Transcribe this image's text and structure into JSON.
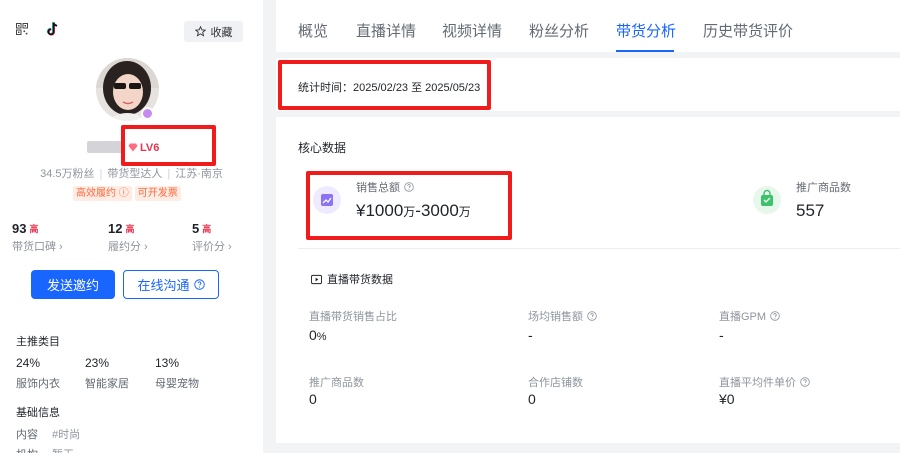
{
  "profile": {
    "favorite_label": "收藏",
    "level": "LV6",
    "fans": "34.5万粉丝",
    "type": "带货型达人",
    "location": "江苏·南京",
    "tags": [
      "高效履约",
      "可开发票"
    ]
  },
  "stats": [
    {
      "value": "93",
      "rank": "高",
      "label": "带货口碑"
    },
    {
      "value": "12",
      "rank": "高",
      "label": "履约分"
    },
    {
      "value": "5",
      "rank": "高",
      "label": "评价分"
    }
  ],
  "actions": {
    "invite": "发送邀约",
    "chat": "在线沟通"
  },
  "categories": {
    "title": "主推类目",
    "items": [
      {
        "pct": "24%",
        "name": "服饰内衣"
      },
      {
        "pct": "23%",
        "name": "智能家居"
      },
      {
        "pct": "13%",
        "name": "母婴宠物"
      }
    ]
  },
  "basic_info": {
    "title": "基础信息",
    "content_label": "内容",
    "content_value": "#时尚",
    "org_label": "机构",
    "org_value": "暂无"
  },
  "tabs": [
    "概览",
    "直播详情",
    "视频详情",
    "粉丝分析",
    "带货分析",
    "历史带货评价"
  ],
  "active_tab": "带货分析",
  "date_range": "统计时间：2025/02/23 至 2025/05/23",
  "core": {
    "title": "核心数据",
    "sales_label": "销售总额",
    "sales_value_a": "¥1000",
    "sales_unit_a": "万",
    "sales_sep": "-",
    "sales_value_b": "3000",
    "sales_unit_b": "万",
    "products_label": "推广商品数",
    "products_value": "557"
  },
  "live": {
    "title": "直播带货数据",
    "metrics": [
      {
        "label": "直播带货销售占比",
        "value": "0",
        "unit": "%",
        "help": false
      },
      {
        "label": "场均销售额",
        "value": "-",
        "unit": "",
        "help": true
      },
      {
        "label": "直播GPM",
        "value": "-",
        "unit": "",
        "help": true
      },
      {
        "label": "推广商品数",
        "value": "0",
        "unit": "",
        "help": false
      },
      {
        "label": "合作店铺数",
        "value": "0",
        "unit": "",
        "help": false
      },
      {
        "label": "直播平均件单价",
        "value": "¥0",
        "unit": "",
        "help": true
      }
    ]
  },
  "colors": {
    "accent": "#1966ff",
    "highlight": "#f01c1c",
    "rank": "#e8344e",
    "tag": "#ff6a3d"
  }
}
